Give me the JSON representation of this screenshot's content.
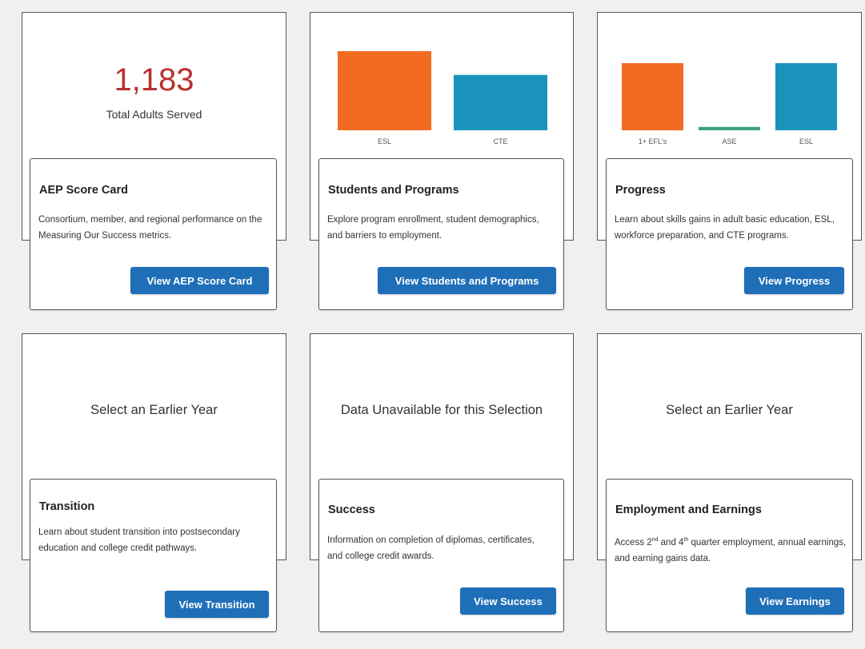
{
  "score_card": {
    "total_value": "1,183",
    "total_label": "Total Adults Served",
    "title": "AEP Score Card",
    "description": "Consortium, member, and regional performance on the Measuring Our Success metrics.",
    "button_label": "View AEP Score Card"
  },
  "students_programs": {
    "title": "Students and Programs",
    "description": "Explore program enrollment, student demographics, and barriers to employment.",
    "button_label": "View Students and Programs"
  },
  "progress": {
    "title": "Progress",
    "description": "Learn about skills gains in adult basic education, ESL, workforce preparation, and CTE programs.",
    "button_label": "View Progress"
  },
  "transition": {
    "message": "Select an Earlier Year",
    "title": "Transition",
    "description": "Learn about student transition into postsecondary education and college credit pathways.",
    "button_label": "View Transition"
  },
  "success": {
    "message": "Data Unavailable for this Selection",
    "title": "Success",
    "description": "Information on completion of diplomas, certificates, and college credit awards.",
    "button_label": "View Success"
  },
  "employment": {
    "message": "Select an Earlier Year",
    "title": "Employment and Earnings",
    "desc_access": "Access 2",
    "desc_sup1": "nd",
    "desc_and": " and 4",
    "desc_sup2": "th",
    "desc_rest": " quarter employment, annual earnings, and earning gains data.",
    "button_label": "View Earnings"
  },
  "chart_data": [
    {
      "type": "bar",
      "categories": [
        "ESL",
        "CTE"
      ],
      "values": [
        100,
        70
      ],
      "colors": [
        "#f26b21",
        "#1a93bc"
      ],
      "ylim": [
        0,
        100
      ]
    },
    {
      "type": "bar",
      "categories": [
        "1+ EFL's",
        "ASE",
        "ESL"
      ],
      "values": [
        100,
        5,
        100
      ],
      "colors": [
        "#f26b21",
        "#3aa37f",
        "#1a93bc"
      ],
      "ylim": [
        0,
        100
      ]
    }
  ]
}
